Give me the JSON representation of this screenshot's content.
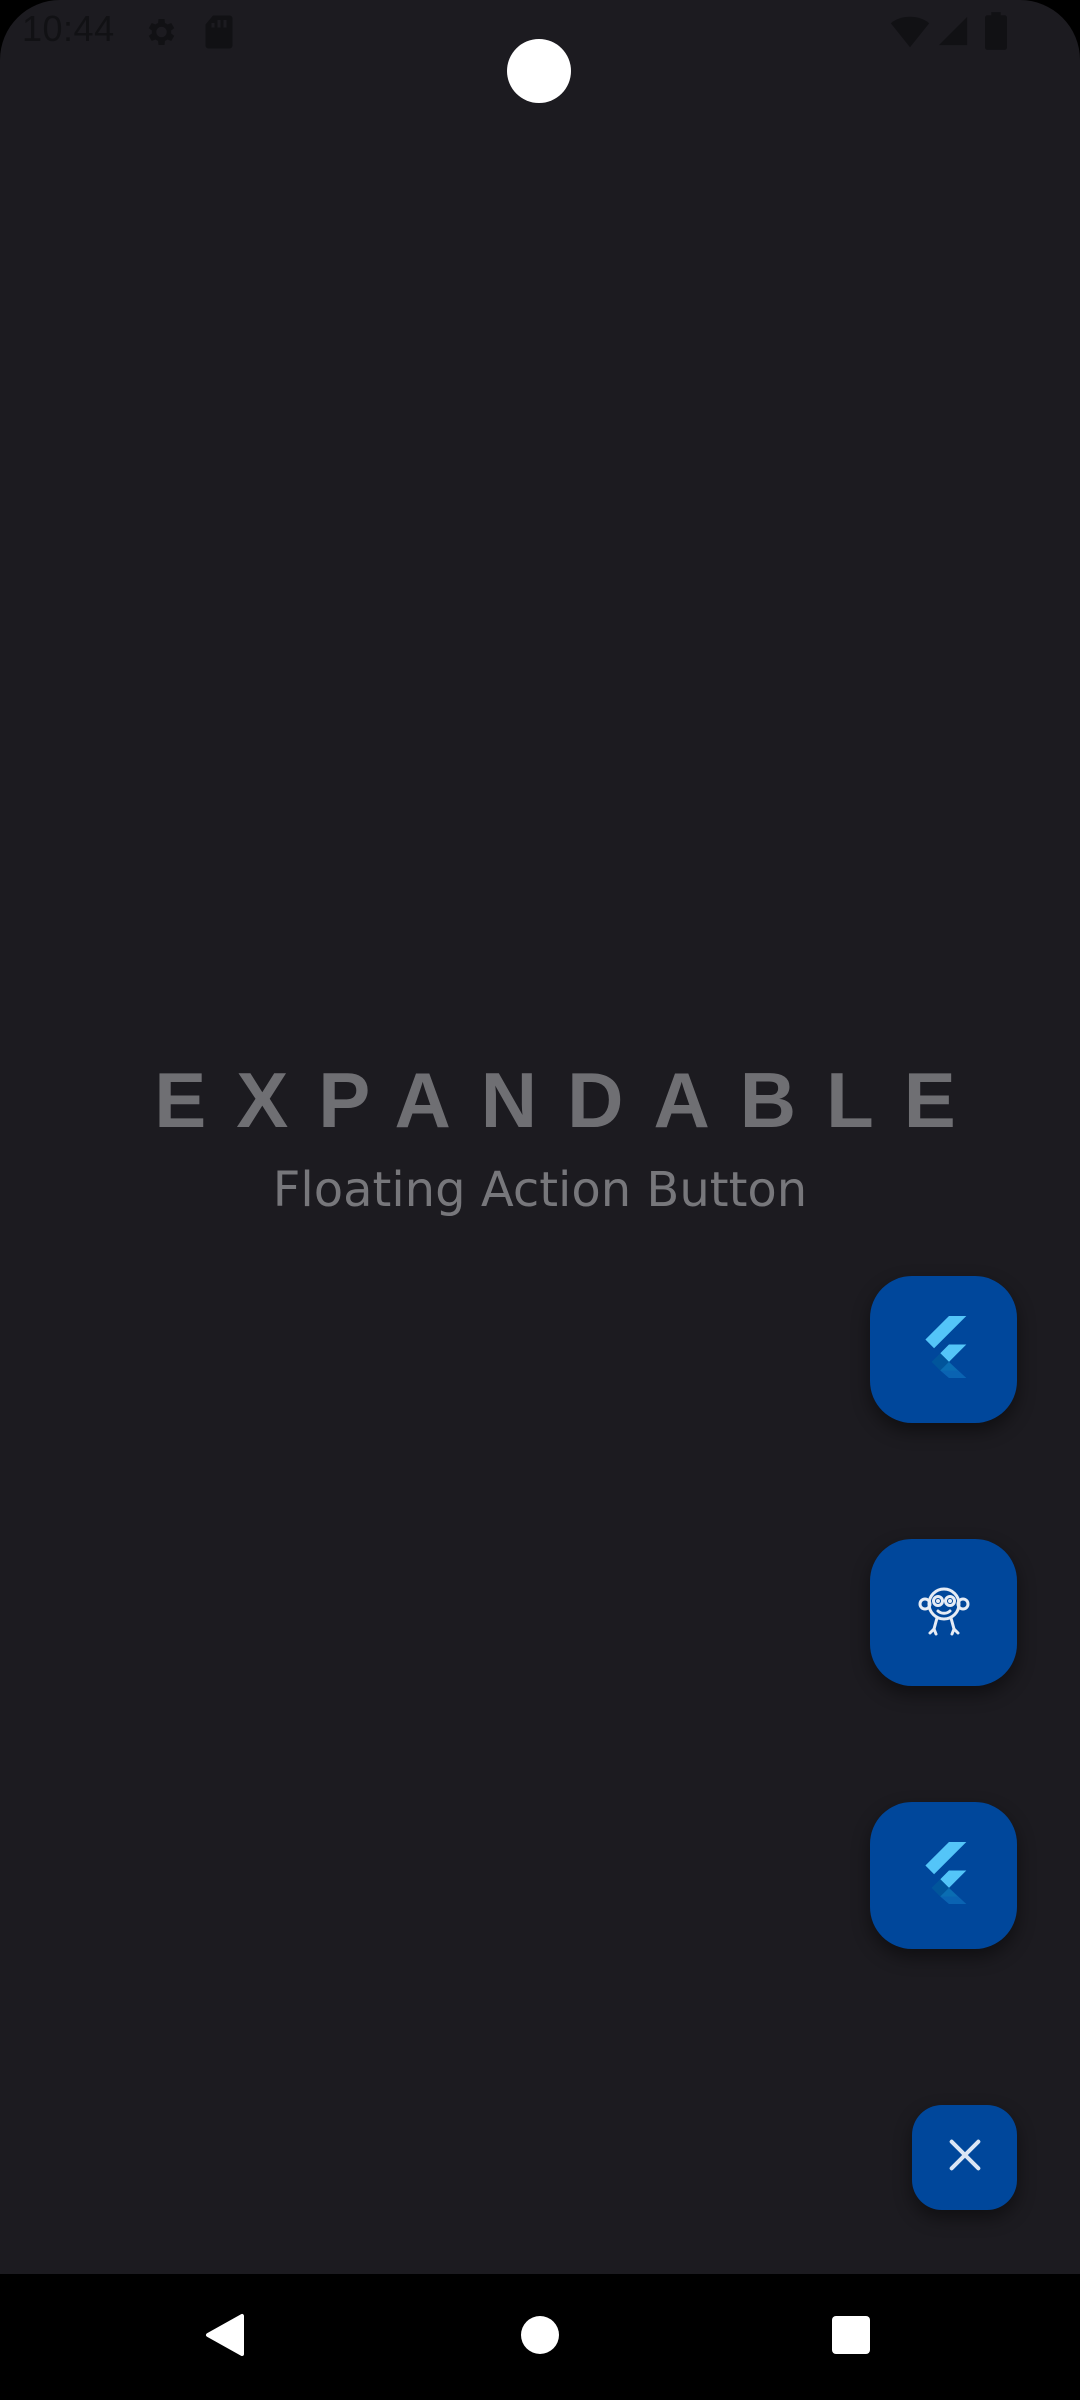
{
  "status_bar": {
    "time": "10:44",
    "icons": [
      "settings-gear-icon",
      "sd-card-icon",
      "wifi-icon",
      "cell-signal-icon",
      "battery-icon"
    ]
  },
  "hero": {
    "title": "EXPANDABLE",
    "subtitle": "Floating Action Button"
  },
  "fab_actions": [
    {
      "icon": "flutter-logo-icon"
    },
    {
      "icon": "monkey-mascot-icon"
    },
    {
      "icon": "flutter-logo-icon"
    }
  ],
  "fab_toggle": {
    "icon": "close-icon",
    "state": "expanded"
  },
  "nav_bar": {
    "buttons": [
      "back-triangle-icon",
      "home-circle-icon",
      "recents-square-icon"
    ]
  },
  "colors": {
    "background": "#1c1b20",
    "fab": "#00479b",
    "flutter_light": "#54c5f8",
    "flutter_dark": "#01579b",
    "text": "#6f6f73"
  }
}
